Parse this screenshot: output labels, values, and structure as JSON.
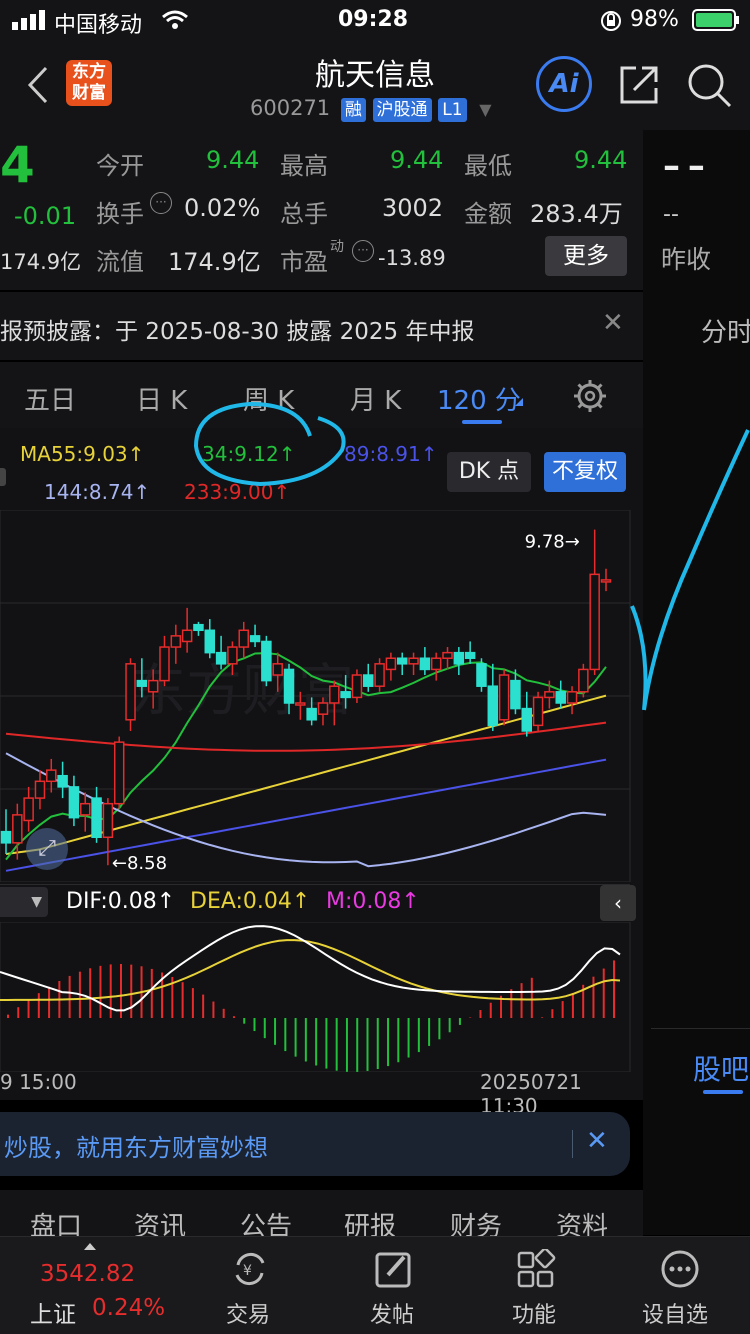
{
  "status_bar": {
    "carrier": "中国移动",
    "time": "09:28",
    "battery": "98%"
  },
  "header": {
    "logo_line1": "东方",
    "logo_line2": "财富",
    "stock_name": "航天信息",
    "stock_code": "600271",
    "badges": [
      "融",
      "沪股通",
      "L1"
    ],
    "ai_label": "Ai"
  },
  "quote": {
    "price_fragment": "4",
    "change": "-0.01",
    "market_cap_fragment": "174.9亿",
    "open_label": "今开",
    "open_value": "9.44",
    "high_label": "最高",
    "high_value": "9.44",
    "low_label": "最低",
    "low_value": "9.44",
    "turnover_label": "换手",
    "turnover_value": "0.02%",
    "volume_label": "总手",
    "volume_value": "3002",
    "amount_label": "金额",
    "amount_value": "283.4万",
    "float_label": "流值",
    "float_value": "174.9亿",
    "pe_label": "市盈",
    "pe_sup": "动",
    "pe_value": "-13.89",
    "more_button": "更多",
    "right_dash": "– –",
    "right_dash2": "--",
    "prev_close_label": "昨收"
  },
  "notice": {
    "text": "报预披露：于 2025-08-30 披露 2025 年中报"
  },
  "right_panel": {
    "tab_top": "分时",
    "tab_bottom": "股吧"
  },
  "period_tabs": [
    {
      "label": "五日",
      "active": false
    },
    {
      "label": "日 K",
      "active": false
    },
    {
      "label": "周 K",
      "active": false
    },
    {
      "label": "月 K",
      "active": false
    },
    {
      "label": "120 分",
      "active": true
    }
  ],
  "ma_legend": {
    "ma55": "MA55:9.03↑",
    "ma34": "34:9.12↑",
    "ma89": "89:8.91↑",
    "ma144": "144:8.74↑",
    "ma233": "233:9.00↑",
    "dk_button": "DK 点",
    "fq_button": "不复权"
  },
  "chart_data": {
    "type": "candlestick",
    "high_label": "9.78→",
    "low_label": "←8.58",
    "high_marker": 9.78,
    "low_marker": 8.58,
    "candles": [
      [
        8.7,
        8.78,
        8.62,
        8.66
      ],
      [
        8.66,
        8.8,
        8.6,
        8.76
      ],
      [
        8.74,
        8.86,
        8.7,
        8.82
      ],
      [
        8.82,
        8.92,
        8.78,
        8.88
      ],
      [
        8.88,
        8.96,
        8.84,
        8.92
      ],
      [
        8.9,
        8.95,
        8.82,
        8.86
      ],
      [
        8.86,
        8.9,
        8.72,
        8.75
      ],
      [
        8.76,
        8.84,
        8.7,
        8.8
      ],
      [
        8.82,
        8.86,
        8.66,
        8.68
      ],
      [
        8.68,
        8.82,
        8.58,
        8.8
      ],
      [
        8.8,
        9.04,
        8.78,
        9.02
      ],
      [
        9.1,
        9.32,
        9.06,
        9.3
      ],
      [
        9.24,
        9.32,
        9.18,
        9.22
      ],
      [
        9.2,
        9.28,
        9.14,
        9.24
      ],
      [
        9.24,
        9.4,
        9.22,
        9.36
      ],
      [
        9.36,
        9.44,
        9.3,
        9.4
      ],
      [
        9.38,
        9.5,
        9.34,
        9.42
      ],
      [
        9.44,
        9.45,
        9.4,
        9.42
      ],
      [
        9.42,
        9.46,
        9.32,
        9.34
      ],
      [
        9.34,
        9.4,
        9.28,
        9.3
      ],
      [
        9.3,
        9.38,
        9.26,
        9.36
      ],
      [
        9.36,
        9.45,
        9.32,
        9.42
      ],
      [
        9.4,
        9.44,
        9.36,
        9.38
      ],
      [
        9.38,
        9.4,
        9.22,
        9.24
      ],
      [
        9.26,
        9.34,
        9.2,
        9.3
      ],
      [
        9.28,
        9.3,
        9.12,
        9.16
      ],
      [
        9.16,
        9.2,
        9.1,
        9.16
      ],
      [
        9.14,
        9.18,
        9.08,
        9.1
      ],
      [
        9.12,
        9.18,
        9.08,
        9.16
      ],
      [
        9.16,
        9.24,
        9.08,
        9.22
      ],
      [
        9.2,
        9.26,
        9.14,
        9.18
      ],
      [
        9.18,
        9.28,
        9.16,
        9.26
      ],
      [
        9.26,
        9.3,
        9.2,
        9.22
      ],
      [
        9.22,
        9.32,
        9.2,
        9.3
      ],
      [
        9.28,
        9.34,
        9.24,
        9.32
      ],
      [
        9.32,
        9.34,
        9.26,
        9.3
      ],
      [
        9.3,
        9.34,
        9.26,
        9.32
      ],
      [
        9.32,
        9.36,
        9.26,
        9.28
      ],
      [
        9.28,
        9.34,
        9.24,
        9.32
      ],
      [
        9.32,
        9.36,
        9.28,
        9.34
      ],
      [
        9.34,
        9.36,
        9.26,
        9.3
      ],
      [
        9.34,
        9.38,
        9.3,
        9.32
      ],
      [
        9.3,
        9.32,
        9.2,
        9.22
      ],
      [
        9.22,
        9.3,
        9.06,
        9.08
      ],
      [
        9.1,
        9.28,
        9.08,
        9.26
      ],
      [
        9.24,
        9.28,
        9.12,
        9.14
      ],
      [
        9.14,
        9.2,
        9.04,
        9.06
      ],
      [
        9.08,
        9.2,
        9.06,
        9.18
      ],
      [
        9.18,
        9.24,
        9.14,
        9.2
      ],
      [
        9.2,
        9.24,
        9.14,
        9.16
      ],
      [
        9.16,
        9.22,
        9.12,
        9.2
      ],
      [
        9.2,
        9.3,
        9.18,
        9.28
      ],
      [
        9.28,
        9.78,
        9.26,
        9.62
      ],
      [
        9.6,
        9.64,
        9.56,
        9.6
      ]
    ]
  },
  "macd": {
    "legend_dif": "DIF:0.08↑",
    "legend_dea": "DEA:0.04↑",
    "legend_m": "M:0.08↑",
    "date_left": "9 15:00",
    "date_right": "20250721 11:30"
  },
  "banner": {
    "text": "炒股，就用东方财富妙想"
  },
  "bottom_tabs": [
    "盘口",
    "资讯",
    "公告",
    "研报",
    "财务",
    "资料"
  ],
  "bottom_nav": {
    "index_value": "3542.82",
    "index_name": "上证",
    "index_change": "0.24%",
    "items": [
      "交易",
      "发帖",
      "功能",
      "设自选"
    ]
  }
}
